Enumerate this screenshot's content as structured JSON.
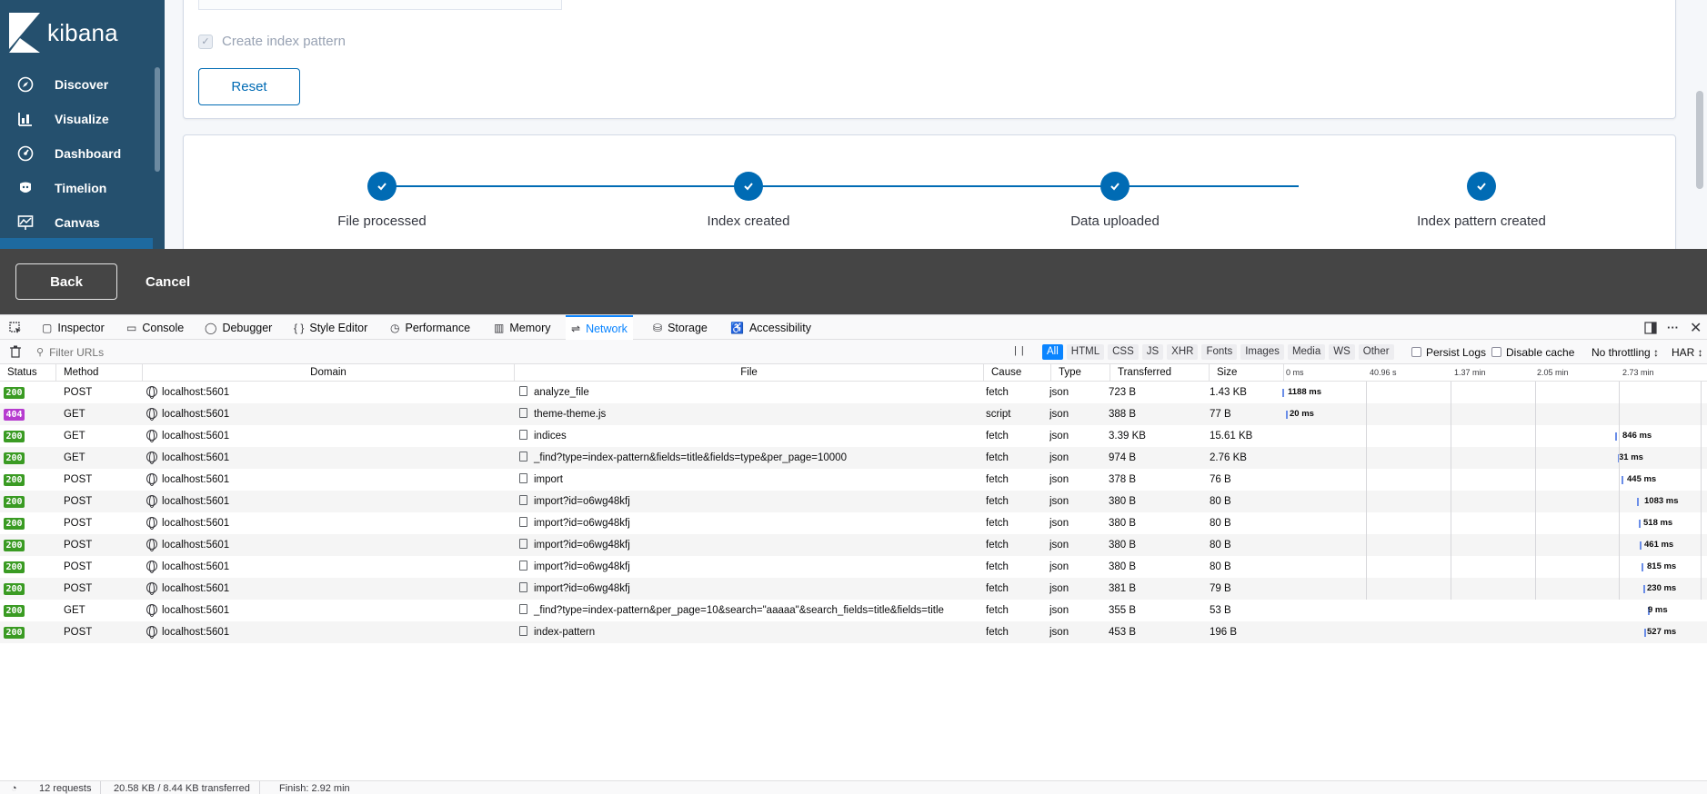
{
  "kibana": {
    "logo_text": "kibana",
    "nav": [
      {
        "label": "Discover",
        "icon": "compass-icon"
      },
      {
        "label": "Visualize",
        "icon": "bar-chart-icon"
      },
      {
        "label": "Dashboard",
        "icon": "dashboard-icon"
      },
      {
        "label": "Timelion",
        "icon": "timelion-icon"
      },
      {
        "label": "Canvas",
        "icon": "canvas-icon"
      }
    ],
    "create_index_pattern_label": "Create index pattern",
    "reset_label": "Reset",
    "steps": [
      "File processed",
      "Index created",
      "Data uploaded",
      "Index pattern created"
    ],
    "back_label": "Back",
    "cancel_label": "Cancel"
  },
  "devtools": {
    "tabs": [
      "Inspector",
      "Console",
      "Debugger",
      "Style Editor",
      "Performance",
      "Memory",
      "Network",
      "Storage",
      "Accessibility"
    ],
    "active_tab": "Network",
    "filter_placeholder": "Filter URLs",
    "type_filters": [
      "All",
      "HTML",
      "CSS",
      "JS",
      "XHR",
      "Fonts",
      "Images",
      "Media",
      "WS",
      "Other"
    ],
    "persist_logs": "Persist Logs",
    "disable_cache": "Disable cache",
    "throttling": "No throttling ↕",
    "har": "HAR ↕",
    "columns": [
      "Status",
      "Method",
      "Domain",
      "File",
      "Cause",
      "Type",
      "Transferred",
      "Size"
    ],
    "timeline_ticks": [
      "0 ms",
      "40.96 s",
      "1.37 min",
      "2.05 min",
      "2.73 min"
    ],
    "requests": [
      {
        "status": "200",
        "method": "POST",
        "domain": "localhost:5601",
        "file": "analyze_file",
        "cause": "fetch",
        "type": "json",
        "transferred": "723 B",
        "size": "1.43 KB",
        "time": "1188 ms"
      },
      {
        "status": "404",
        "method": "GET",
        "domain": "localhost:5601",
        "file": "theme-theme.js",
        "cause": "script",
        "type": "json",
        "transferred": "388 B",
        "size": "77 B",
        "time": "20 ms"
      },
      {
        "status": "200",
        "method": "GET",
        "domain": "localhost:5601",
        "file": "indices",
        "cause": "fetch",
        "type": "json",
        "transferred": "3.39 KB",
        "size": "15.61 KB",
        "time": "846 ms"
      },
      {
        "status": "200",
        "method": "GET",
        "domain": "localhost:5601",
        "file": "_find?type=index-pattern&fields=title&fields=type&per_page=10000",
        "cause": "fetch",
        "type": "json",
        "transferred": "974 B",
        "size": "2.76 KB",
        "time": "31 ms"
      },
      {
        "status": "200",
        "method": "POST",
        "domain": "localhost:5601",
        "file": "import",
        "cause": "fetch",
        "type": "json",
        "transferred": "378 B",
        "size": "76 B",
        "time": "445 ms"
      },
      {
        "status": "200",
        "method": "POST",
        "domain": "localhost:5601",
        "file": "import?id=o6wg48kfj",
        "cause": "fetch",
        "type": "json",
        "transferred": "380 B",
        "size": "80 B",
        "time": "1083 ms"
      },
      {
        "status": "200",
        "method": "POST",
        "domain": "localhost:5601",
        "file": "import?id=o6wg48kfj",
        "cause": "fetch",
        "type": "json",
        "transferred": "380 B",
        "size": "80 B",
        "time": "518 ms"
      },
      {
        "status": "200",
        "method": "POST",
        "domain": "localhost:5601",
        "file": "import?id=o6wg48kfj",
        "cause": "fetch",
        "type": "json",
        "transferred": "380 B",
        "size": "80 B",
        "time": "461 ms"
      },
      {
        "status": "200",
        "method": "POST",
        "domain": "localhost:5601",
        "file": "import?id=o6wg48kfj",
        "cause": "fetch",
        "type": "json",
        "transferred": "380 B",
        "size": "80 B",
        "time": "815 ms"
      },
      {
        "status": "200",
        "method": "POST",
        "domain": "localhost:5601",
        "file": "import?id=o6wg48kfj",
        "cause": "fetch",
        "type": "json",
        "transferred": "381 B",
        "size": "79 B",
        "time": "230 ms"
      },
      {
        "status": "200",
        "method": "GET",
        "domain": "localhost:5601",
        "file": "_find?type=index-pattern&per_page=10&search=\"aaaaa\"&search_fields=title&fields=title",
        "cause": "fetch",
        "type": "json",
        "transferred": "355 B",
        "size": "53 B",
        "time": "9 ms"
      },
      {
        "status": "200",
        "method": "POST",
        "domain": "localhost:5601",
        "file": "index-pattern",
        "cause": "fetch",
        "type": "json",
        "transferred": "453 B",
        "size": "196 B",
        "time": "527 ms"
      }
    ],
    "summary": {
      "requests": "12 requests",
      "transferred": "20.58 KB / 8.44 KB transferred",
      "finish": "Finish: 2.92 min"
    }
  },
  "colors": {
    "ok": "#3a9b23",
    "not_found": "#b63bcf",
    "accent": "#006bb4",
    "devtools_active": "#0a84ff"
  }
}
